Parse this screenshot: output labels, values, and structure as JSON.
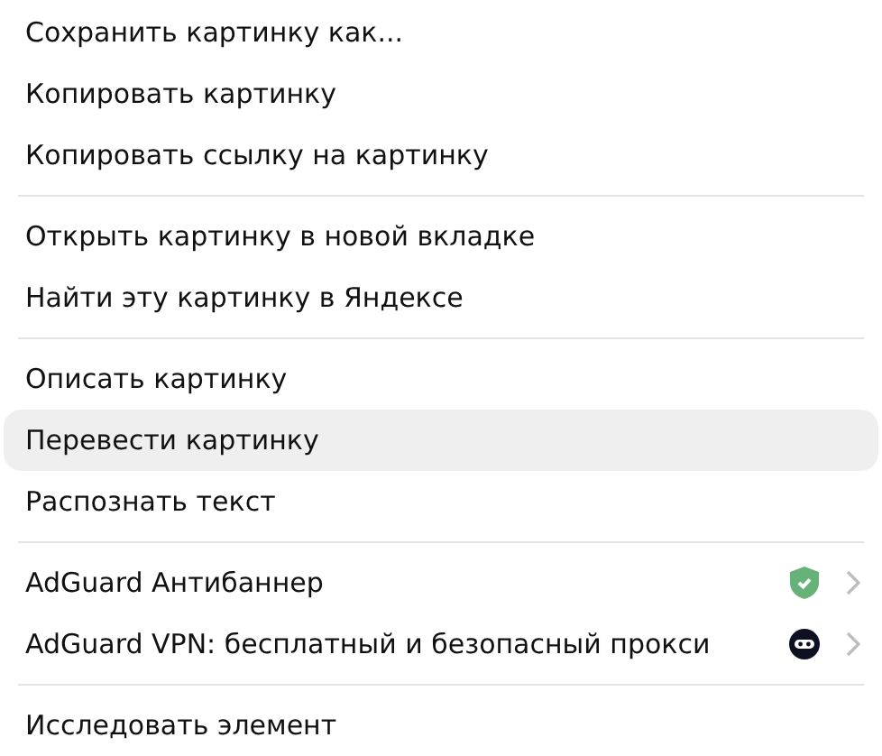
{
  "menu": {
    "groups": [
      {
        "items": [
          {
            "label": "Сохранить картинку как...",
            "selected": false,
            "submenu": false
          },
          {
            "label": "Копировать картинку",
            "selected": false,
            "submenu": false
          },
          {
            "label": "Копировать ссылку на картинку",
            "selected": false,
            "submenu": false
          }
        ]
      },
      {
        "items": [
          {
            "label": "Открыть картинку в новой вкладке",
            "selected": false,
            "submenu": false
          },
          {
            "label": "Найти эту картинку в Яндексе",
            "selected": false,
            "submenu": false
          }
        ]
      },
      {
        "items": [
          {
            "label": "Описать картинку",
            "selected": false,
            "submenu": false
          },
          {
            "label": "Перевести картинку",
            "selected": true,
            "submenu": false
          },
          {
            "label": "Распознать текст",
            "selected": false,
            "submenu": false
          }
        ]
      },
      {
        "items": [
          {
            "label": "AdGuard Антибаннер",
            "selected": false,
            "submenu": true,
            "kind": "shield"
          },
          {
            "label": "AdGuard VPN: бесплатный и безопасный прокси",
            "selected": false,
            "submenu": true,
            "kind": "mask"
          }
        ]
      },
      {
        "items": [
          {
            "label": "Исследовать элемент",
            "selected": false,
            "submenu": false
          }
        ]
      }
    ]
  }
}
